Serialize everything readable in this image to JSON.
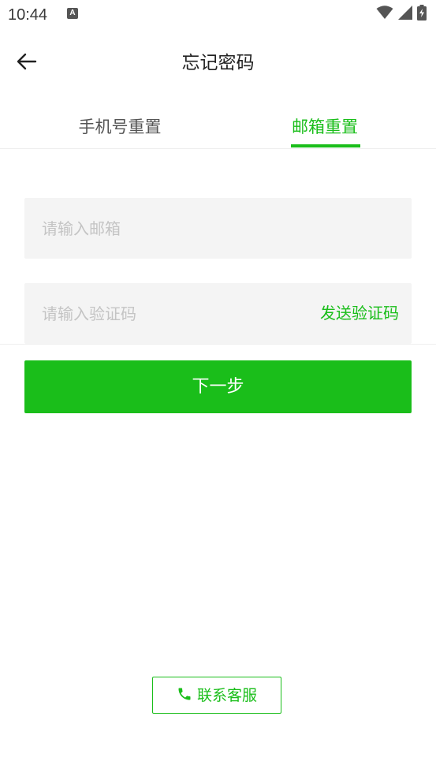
{
  "status_bar": {
    "time": "10:44",
    "notification_icon": "A",
    "icons": [
      "wifi-icon",
      "signal-icon",
      "battery-charging-icon"
    ]
  },
  "header": {
    "title": "忘记密码",
    "back_icon": "arrow-left-icon"
  },
  "tabs": [
    {
      "label": "手机号重置",
      "active": false
    },
    {
      "label": "邮箱重置",
      "active": true
    }
  ],
  "form": {
    "email": {
      "value": "",
      "placeholder": "请输入邮箱"
    },
    "code": {
      "value": "",
      "placeholder": "请输入验证码"
    },
    "send_code_label": "发送验证码",
    "next_label": "下一步"
  },
  "contact": {
    "label": "联系客服",
    "icon": "phone-icon"
  },
  "colors": {
    "accent": "#1ABE1A",
    "input_bg": "#f4f4f4",
    "placeholder": "#c4c4c4"
  }
}
